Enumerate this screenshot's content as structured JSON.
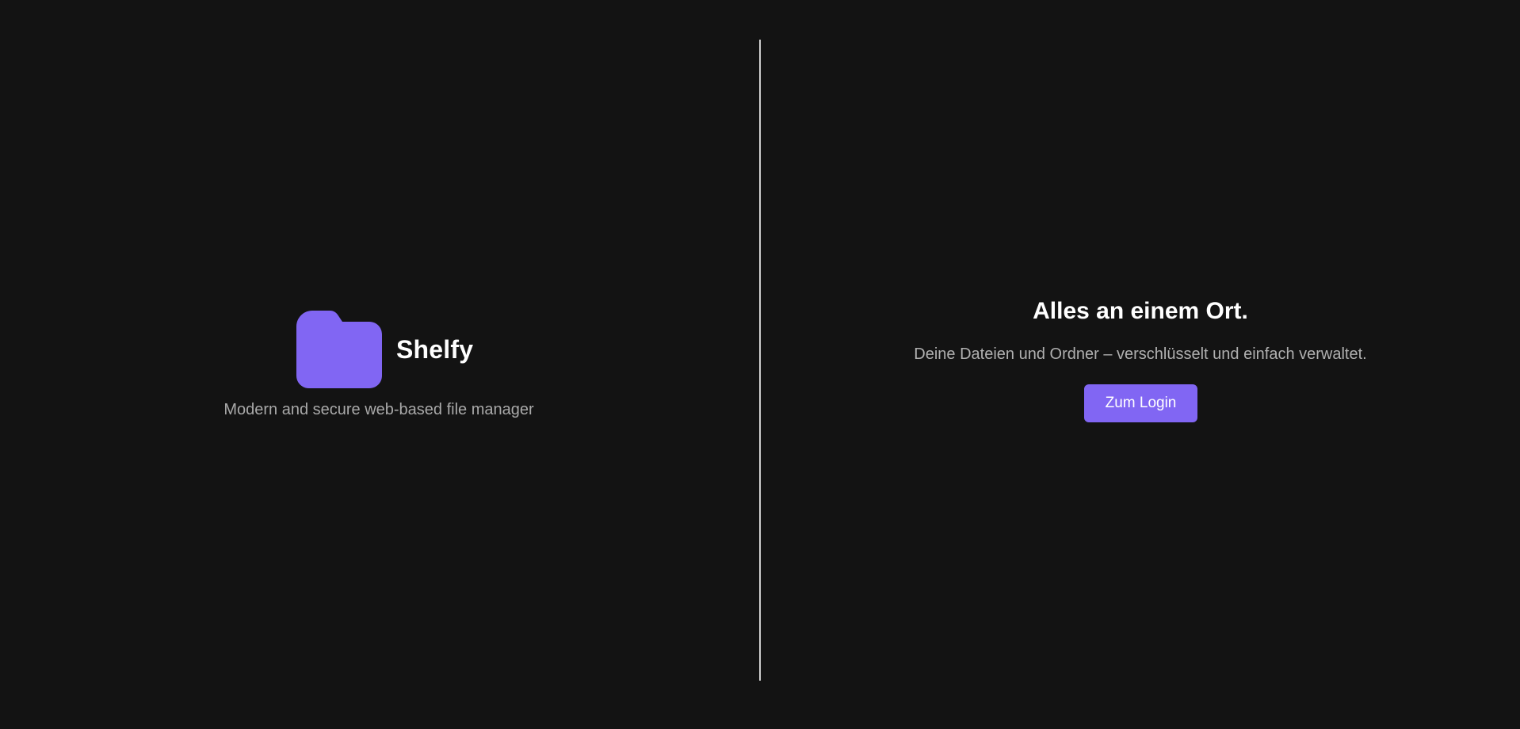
{
  "colors": {
    "background": "#131313",
    "accent": "#8166f3",
    "divider": "#cfcfcf",
    "muted_text": "#a9a9a9"
  },
  "brand": {
    "icon": "folder-icon",
    "name": "Shelfy",
    "tagline": "Modern and secure web-based file manager"
  },
  "hero": {
    "headline": "Alles an einem Ort.",
    "subline": "Deine Dateien und Ordner – verschlüsselt und einfach verwaltet.",
    "login_label": "Zum Login"
  }
}
